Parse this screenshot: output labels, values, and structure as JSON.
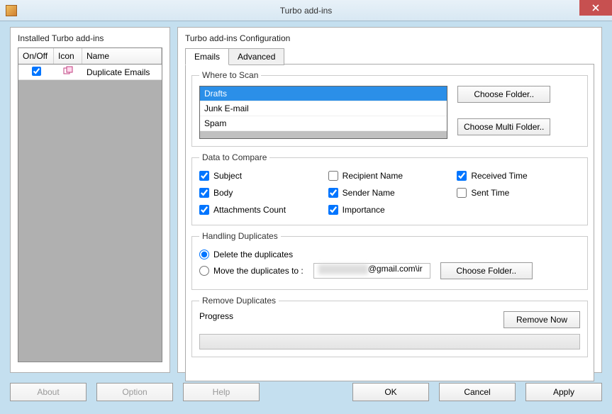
{
  "window": {
    "title": "Turbo add-ins"
  },
  "left": {
    "heading": "Installed Turbo add-ins",
    "headers": {
      "onoff": "On/Off",
      "icon": "Icon",
      "name": "Name"
    },
    "rows": [
      {
        "checked": true,
        "name": "Duplicate Emails"
      }
    ]
  },
  "right": {
    "heading": "Turbo add-ins Configuration",
    "tabs": {
      "emails": "Emails",
      "advanced": "Advanced"
    },
    "scan": {
      "legend": "Where to Scan",
      "items": [
        "Drafts",
        "Junk E-mail",
        "Spam"
      ],
      "selected_index": 0,
      "choose_folder": "Choose Folder..",
      "choose_multi": "Choose Multi Folder.."
    },
    "compare": {
      "legend": "Data to Compare",
      "subject": "Subject",
      "body": "Body",
      "attachments": "Attachments Count",
      "recipient": "Recipient Name",
      "sender": "Sender Name",
      "importance": "Importance",
      "received": "Received Time",
      "sent": "Sent Time",
      "checked": {
        "subject": true,
        "body": true,
        "attachments": true,
        "recipient": false,
        "sender": true,
        "importance": true,
        "received": true,
        "sent": false
      }
    },
    "handling": {
      "legend": "Handling Duplicates",
      "delete": "Delete the duplicates",
      "move": "Move the duplicates to :",
      "selected": "delete",
      "move_path": "\\\\              @gmail.com\\ir",
      "choose_folder": "Choose Folder.."
    },
    "remove": {
      "legend": "Remove Duplicates",
      "progress_label": "Progress",
      "remove_now": "Remove Now"
    }
  },
  "buttons": {
    "about": "About",
    "option": "Option",
    "help": "Help",
    "ok": "OK",
    "cancel": "Cancel",
    "apply": "Apply"
  }
}
